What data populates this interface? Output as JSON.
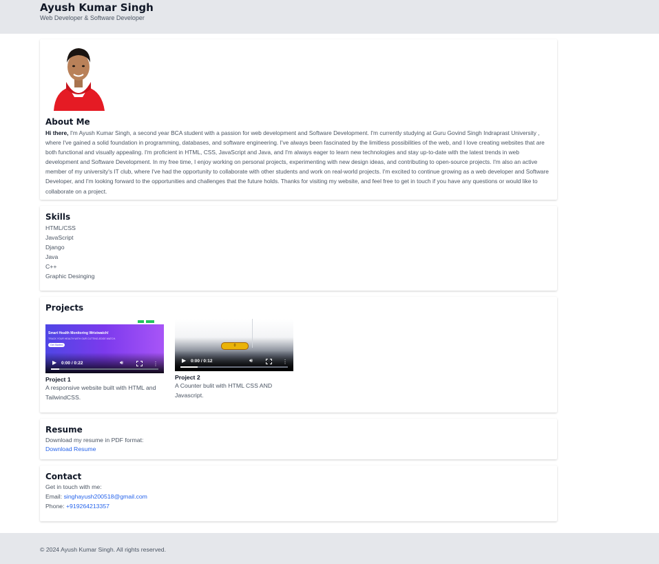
{
  "header": {
    "name": "Ayush Kumar Singh",
    "tagline": "Web Developer & Software Developer"
  },
  "about": {
    "heading": "About Me",
    "greeting": "Hi there,",
    "body": " I'm Ayush Kumar Singh, a second year BCA student with a passion for web development and Software Development. I'm currently studying at Guru Govind Singh Indraprast University , where I've gained a solid foundation in programming, databases, and software engineering. I've always been fascinated by the limitless possibilities of the web, and I love creating websites that are both functional and visually appealing. I'm proficient in HTML, CSS, JavaScript and Java, and I'm always eager to learn new technologies and stay up-to-date with the latest trends in web development and Software Development. In my free time, I enjoy working on personal projects, experimenting with new design ideas, and contributing to open-source projects. I'm also an active member of my university's IT club, where I've had the opportunity to collaborate with other students and work on real-world projects. I'm excited to continue growing as a web developer and Software Developer, and I'm looking forward to the opportunities and challenges that the future holds. Thanks for visiting my website, and feel free to get in touch if you have any questions or would like to collaborate on a project."
  },
  "skills": {
    "heading": "Skills",
    "items": [
      "HTML/CSS",
      "JavaScript",
      "Django",
      "Java",
      "C++",
      "Graphic Desinging"
    ]
  },
  "projects": {
    "heading": "Projects",
    "items": [
      {
        "title": "Project 1",
        "desc": "A responsive website built with HTML and TailwindCSS.",
        "time": "0:00 / 0:22",
        "thumb_heading": "Smart Health Monitoring Wristwatch!",
        "thumb_sub": "TRACK YOUR HEALTH WITH OUR CUTTING-EDGE WATCH.",
        "thumb_button": "Get Started"
      },
      {
        "title": "Project 2",
        "desc": "A Counter bulit with HTML CSS AND Javascript.",
        "time": "0:00 / 0:12",
        "thumb_counter": "0"
      }
    ]
  },
  "resume": {
    "heading": "Resume",
    "text": "Download my resume in PDF format:",
    "link": "Download Resume"
  },
  "contact": {
    "heading": "Contact",
    "intro": "Get in touch with me:",
    "email_label": "Email: ",
    "email": "singhayush200518@gmail.com",
    "phone_label": "Phone: ",
    "phone": "+919264213357"
  },
  "footer": {
    "text": "© 2024 Ayush Kumar Singh. All rights reserved."
  },
  "colors": {
    "header_bg": "#e5e7eb",
    "link": "#2563eb",
    "hoodie": "#e51b24"
  }
}
